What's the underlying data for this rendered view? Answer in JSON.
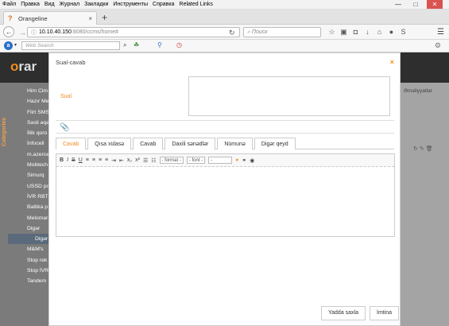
{
  "menubar": {
    "items": [
      "Файл",
      "Правка",
      "Вид",
      "Журнал",
      "Закладки",
      "Инструменты",
      "Справка",
      "Related Links"
    ]
  },
  "window": {
    "min": "—",
    "max": "□",
    "close": "✕"
  },
  "browser": {
    "tab_title": "Orangeline",
    "tab_close": "×",
    "new_tab": "+",
    "url_host": "10.10.40.150",
    "url_path": ":8080/ccms/home#",
    "search_placeholder": "Поиск"
  },
  "toolbar2": {
    "web_search_placeholder": "Web Search"
  },
  "app": {
    "logo_o": "o",
    "logo_rest": "rar",
    "categories_label": "Categories",
    "right_label": "Əməliyyatlar",
    "sidebar_items": [
      "Him Cim",
      "Hazır Me",
      "Flirt SMS",
      "Səsli əqə",
      "İllik qoro",
      "İnfocell",
      "m.azerce",
      "Mobtech",
      "Simurq",
      "USSD po",
      "İVR RBT",
      "Baltika p",
      "Melomar",
      "Digər",
      "Digər",
      "M&M's",
      "Stop rek",
      "Stop İVR",
      "Tandem"
    ],
    "selected_index": 14
  },
  "modal": {
    "title": "Sual-cavab",
    "close": "×",
    "question_label": "Sual",
    "attach_icon": "paperclip-icon",
    "tabs": [
      "Cavab",
      "Qısa xülasə",
      "Cavab",
      "Daxili sənədlər",
      "Nümunə",
      "Digər qeyd"
    ],
    "active_tab": 0,
    "format_select": "- format -",
    "font_select": "- font -",
    "size_select": "-",
    "save_button": "Yadda saxla",
    "cancel_button": "İmtina"
  },
  "colors": {
    "accent": "#f18c1e",
    "header": "#2e2e2e"
  }
}
